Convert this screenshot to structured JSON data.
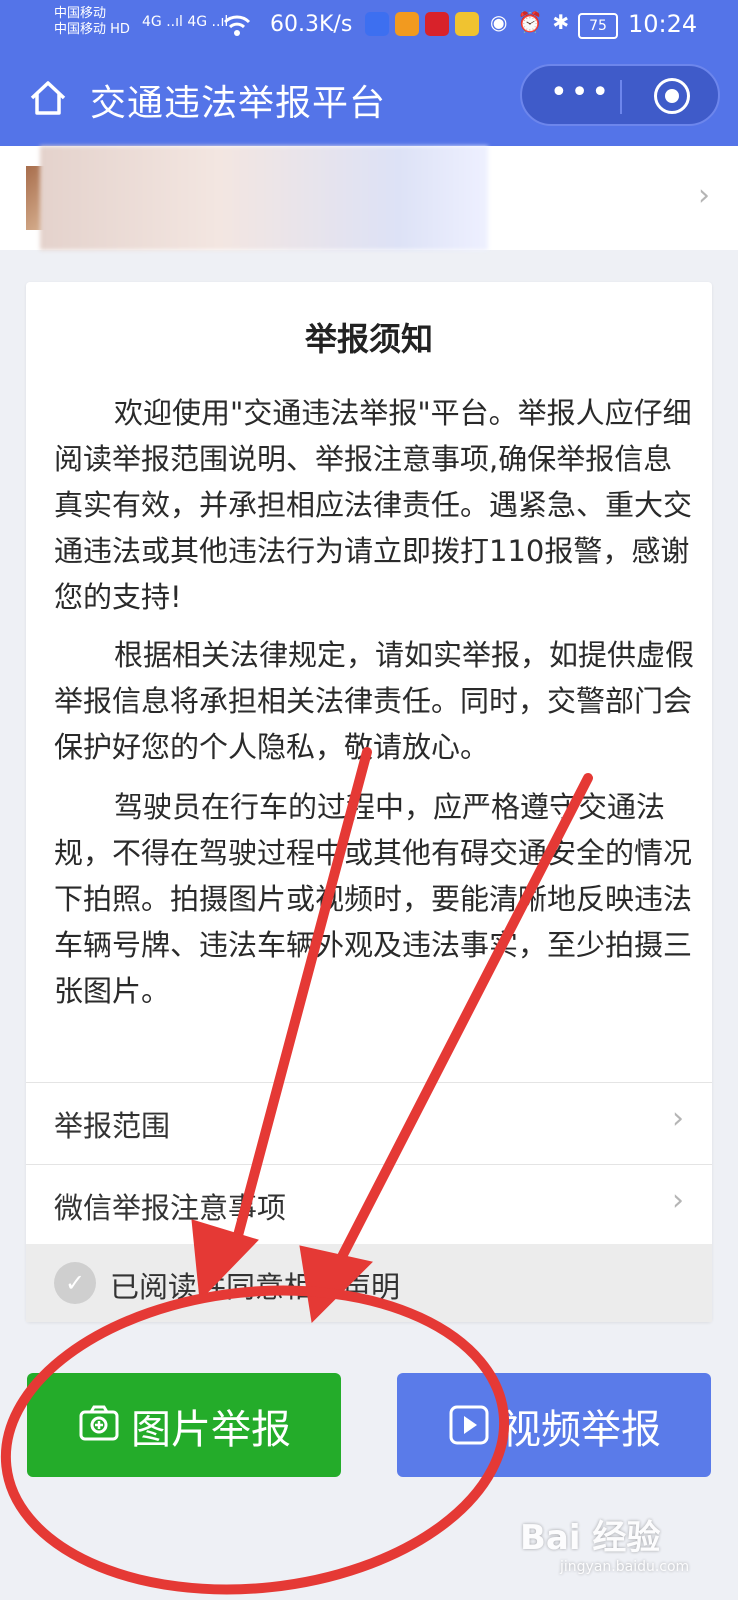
{
  "status_bar": {
    "carrier_1": "中国移动",
    "carrier_2": "中国移动 HD",
    "network": "4G ..ıl 4G ..ıl",
    "net_speed": "60.3K/s",
    "battery": "75",
    "time": "10:24",
    "icons": [
      "wifi-icon",
      "bulb-app-icon",
      "video-app-icon",
      "news-app-icon",
      "weibo-app-icon",
      "eye-icon",
      "alarm-icon",
      "bluetooth-icon",
      "battery-icon"
    ]
  },
  "nav": {
    "title": "交通违法举报平台",
    "more_glyph": "•••",
    "icons": [
      "home-icon",
      "more-icon",
      "target-icon"
    ]
  },
  "notice": {
    "title": "举报须知",
    "paragraphs": [
      "欢迎使用\"交通违法举报\"平台。举报人应仔细阅读举报范围说明、举报注意事项,确保举报信息真实有效，并承担相应法律责任。遇紧急、重大交通违法或其他违法行为请立即拨打110报警，感谢您的支持!",
      "根据相关法律规定，请如实举报，如提供虚假举报信息将承担相关法律责任。同时，交警部门会保护好您的个人隐私，敬请放心。",
      "驾驶员在行车的过程中，应严格遵守交通法规，不得在驾驶过程中或其他有碍交通安全的情况下拍照。拍摄图片或视频时，要能清晰地反映违法车辆号牌、违法车辆外观及违法事实，至少拍摄三张图片。"
    ],
    "rows": [
      "举报范围",
      "微信举报注意事项"
    ],
    "agree_label": "已阅读并同意相关声明"
  },
  "buttons": {
    "photo": "图片举报",
    "video": "视频举报"
  },
  "watermark": {
    "text": "Bai 经验",
    "sub": "jingyan.baidu.com"
  },
  "colors": {
    "header": "#5474e8",
    "photo_button": "#24ac2a",
    "video_button": "#5a7be9",
    "annotation": "#e53935"
  }
}
